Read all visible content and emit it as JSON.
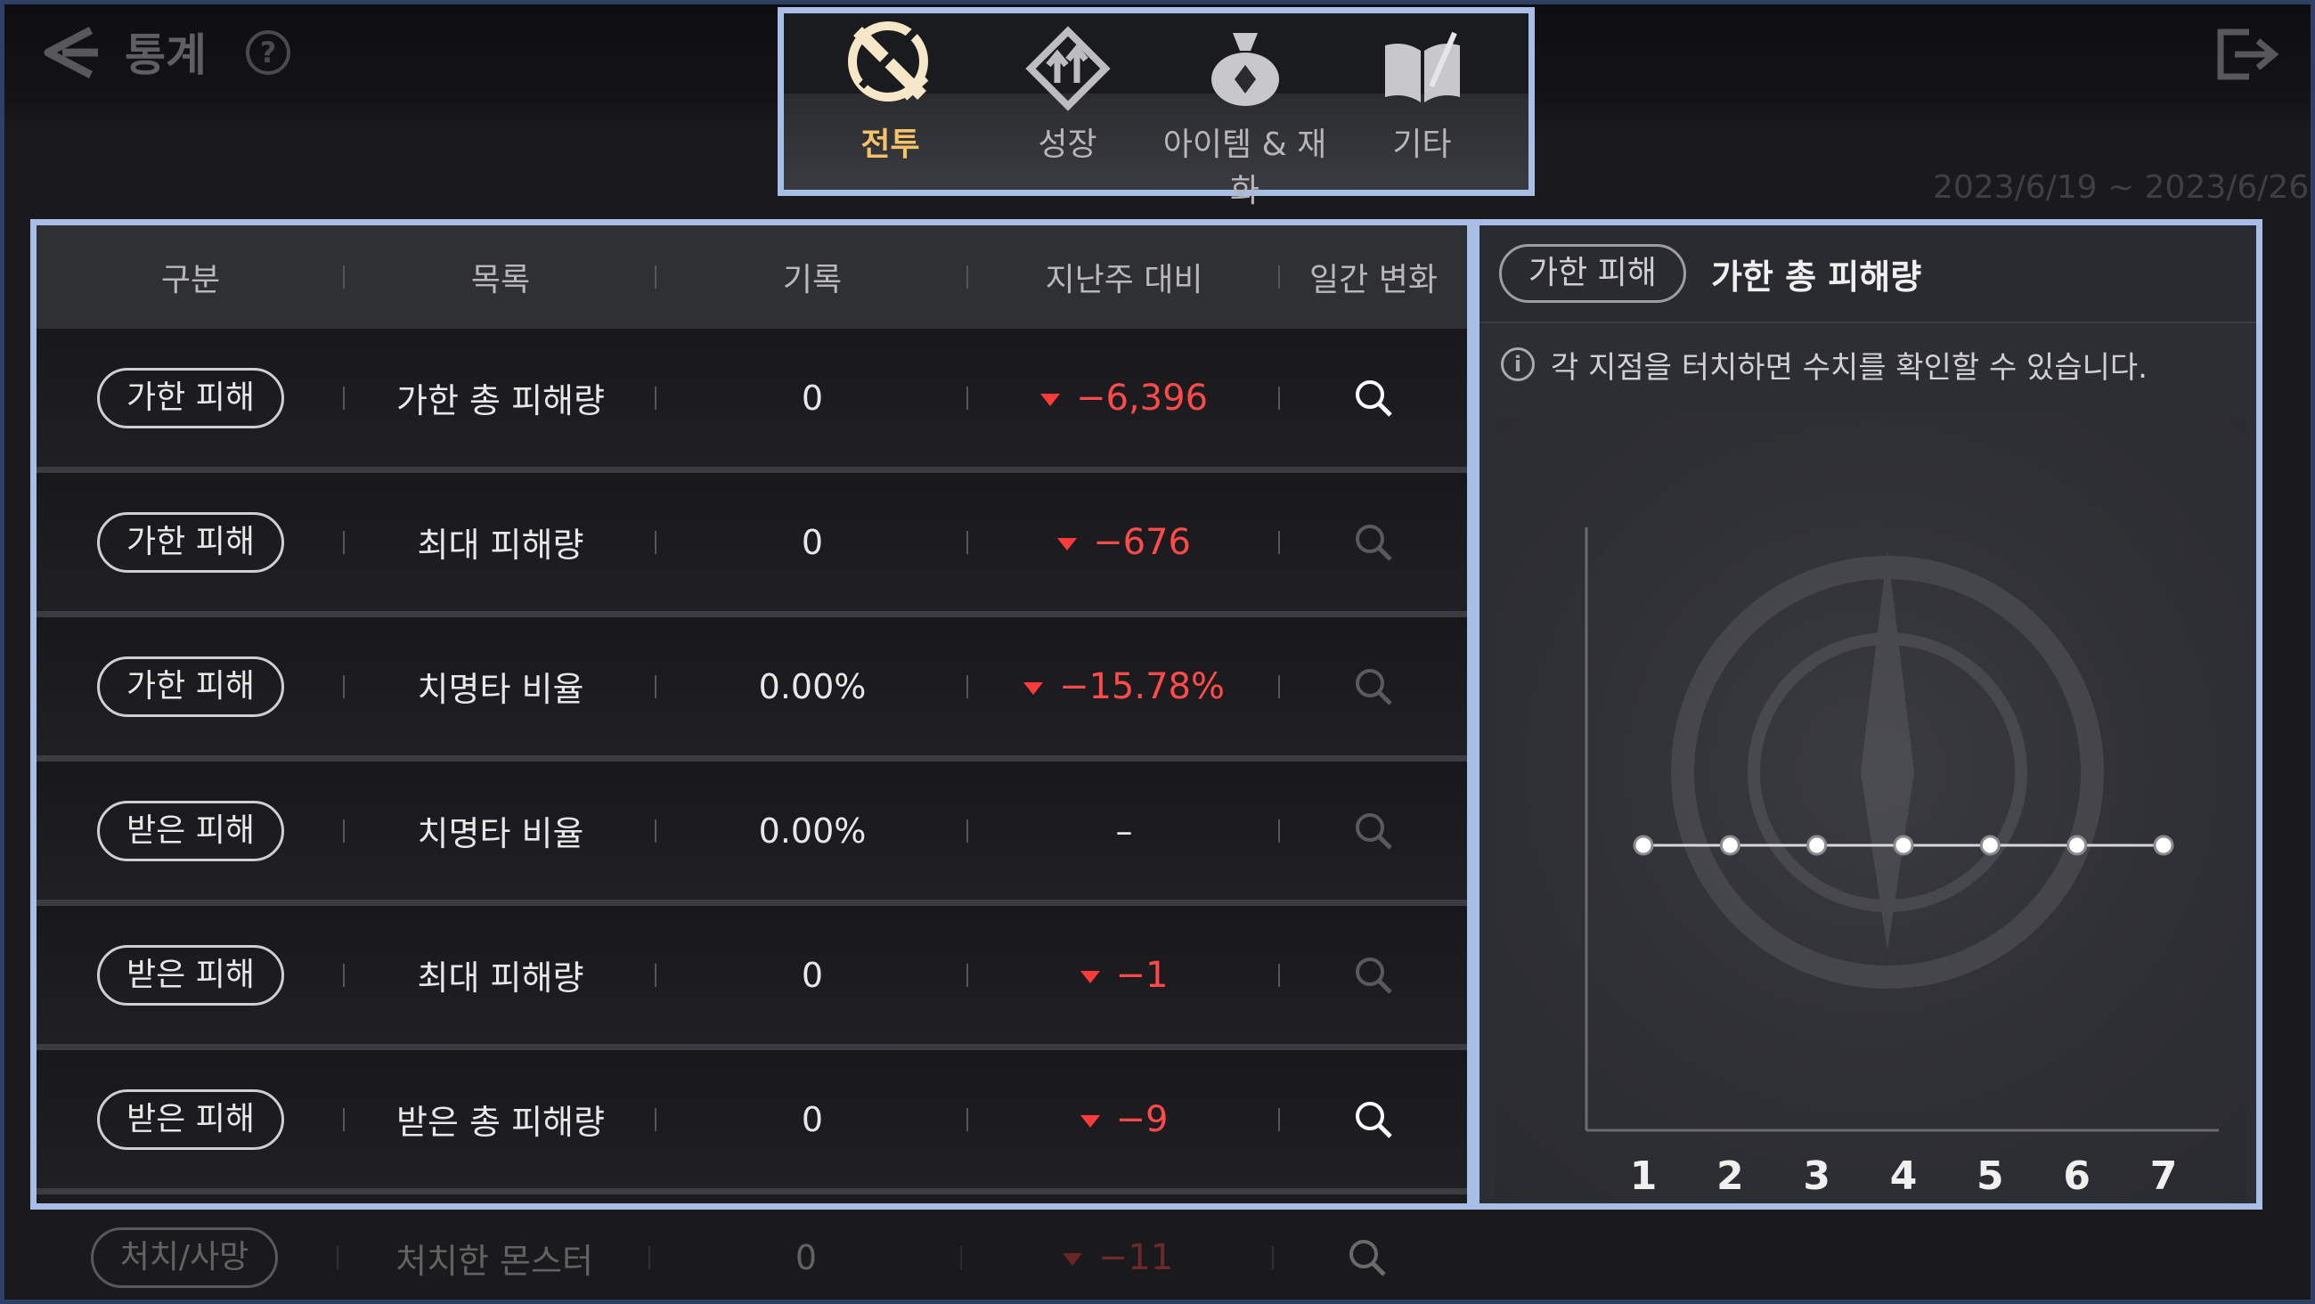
{
  "header": {
    "title": "통계",
    "help_label": "?"
  },
  "tabs": [
    {
      "label": "전투",
      "icon": "crossed-swords-icon",
      "active": true
    },
    {
      "label": "성장",
      "icon": "growth-arrows-icon",
      "active": false
    },
    {
      "label": "아이템 & 재화",
      "icon": "money-bag-icon",
      "active": false
    },
    {
      "label": "기타",
      "icon": "book-icon",
      "active": false
    }
  ],
  "date_range": "2023/6/19 ~ 2023/6/26",
  "table": {
    "columns": [
      "구분",
      "목록",
      "기록",
      "지난주 대비",
      "일간 변화"
    ],
    "rows": [
      {
        "category": "가한 피해",
        "item": "가한 총 피해량",
        "record": "0",
        "delta": "−6,396",
        "down": true,
        "magnifier_active": true
      },
      {
        "category": "가한 피해",
        "item": "최대 피해량",
        "record": "0",
        "delta": "−676",
        "down": true,
        "magnifier_active": false
      },
      {
        "category": "가한 피해",
        "item": "치명타 비율",
        "record": "0.00%",
        "delta": "−15.78%",
        "down": true,
        "magnifier_active": false
      },
      {
        "category": "받은 피해",
        "item": "치명타 비율",
        "record": "0.00%",
        "delta": "–",
        "down": false,
        "magnifier_active": false
      },
      {
        "category": "받은 피해",
        "item": "최대 피해량",
        "record": "0",
        "delta": "−1",
        "down": true,
        "magnifier_active": false
      },
      {
        "category": "받은 피해",
        "item": "받은 총 피해량",
        "record": "0",
        "delta": "−9",
        "down": true,
        "magnifier_active": true
      }
    ],
    "overflow_row": {
      "category": "처치/사망",
      "item": "처치한 몬스터",
      "record": "0",
      "delta": "−11",
      "down": true
    }
  },
  "detail": {
    "category": "가한 피해",
    "title": "가한 총 피해량",
    "notice": "각 지점을 터치하면 수치를 확인할 수 있습니다.",
    "info_icon": "i"
  },
  "chart_data": {
    "type": "line",
    "categories": [
      "1",
      "2",
      "3",
      "4",
      "5",
      "6",
      "7"
    ],
    "series": [
      {
        "values": [
          0,
          0,
          0,
          0,
          0,
          0,
          0
        ]
      }
    ],
    "grid": false
  },
  "colors": {
    "accent_active_tab": "#f5c26b",
    "negative_delta": "#ff4a4a",
    "highlight_border": "#a9bee6"
  }
}
